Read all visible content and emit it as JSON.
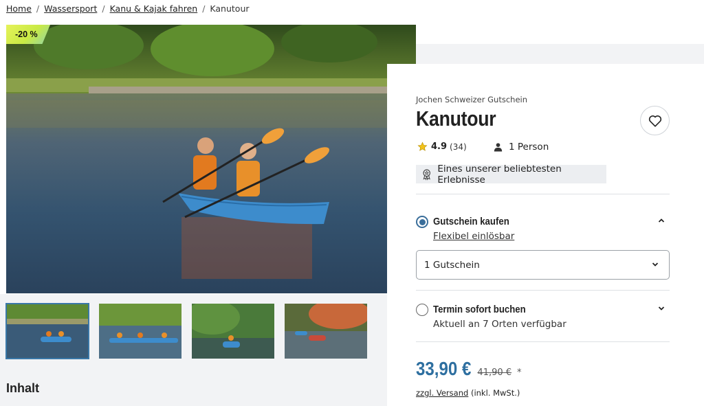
{
  "breadcrumb": {
    "items": [
      "Home",
      "Wassersport",
      "Kanu & Kajak fahren"
    ],
    "current": "Kanutour",
    "separator": "/"
  },
  "gallery": {
    "discount_badge": "-20 %",
    "main_image_icon": "kayak-photo",
    "thumbnail_count": 4
  },
  "section": {
    "title": "Inhalt"
  },
  "product": {
    "provider": "Jochen Schweizer Gutschein",
    "title": "Kanutour",
    "rating_value": "4.9",
    "rating_count": "(34)",
    "persons": "1 Person",
    "popular_tag": "Eines unserer beliebtesten Erlebnisse",
    "options": [
      {
        "label": "Gutschein kaufen",
        "sub": "Flexibel einlösbar",
        "selected": true
      },
      {
        "label": "Termin sofort buchen",
        "sub": "Aktuell an 7 Orten verfügbar",
        "selected": false
      }
    ],
    "quantity_select": "1 Gutschein",
    "price_now": "33,90 €",
    "price_old": "41,90 €",
    "price_footnote": "*",
    "shipping_link": "zzgl. Versand",
    "shipping_note": "(inkl. MwSt.)"
  },
  "colors": {
    "accent": "#2e6fa0",
    "badge": "#d8ee4f",
    "star": "#f2c21b"
  }
}
